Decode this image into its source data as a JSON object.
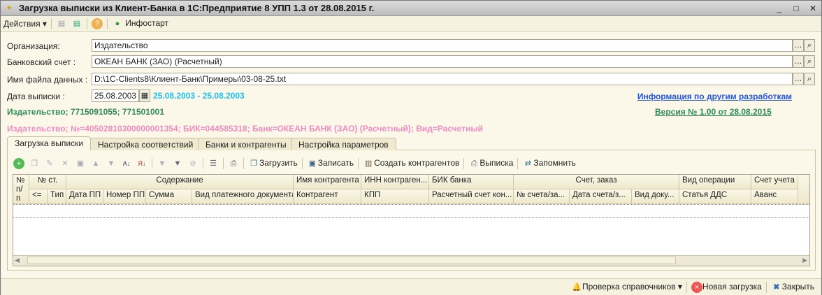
{
  "window": {
    "title": "Загрузка выписки из Клиент-Банка в 1С:Предприятие 8 УПП 1.3 от 28.08.2015 г."
  },
  "toolbar": {
    "actions": "Действия",
    "infostart": "Инфостарт"
  },
  "form": {
    "org_label": "Организация:",
    "org_value": "Издательство",
    "account_label": "Банковский счет :",
    "account_value": "ОКЕАН БАНК (ЗАО) (Расчетный)",
    "file_label": "Имя файла данных :",
    "file_value": "D:\\1C-Clients8\\Клиент-Банк\\Примеры\\03-08-25.txt",
    "date_label": "Дата выписки :",
    "date_value": "25.08.2003",
    "date_range": "25.08.2003 - 25.08.2003",
    "other_dev_link": "Информация по другим разработкам",
    "org_info": "Издательство; 7715091055; 771501001",
    "version_link": "Версия № 1.00 от 28.08.2015",
    "account_info": "Издательство; №=40502810300000001354; БИК=044585318; Банк=ОКЕАН БАНК (ЗАО) (Расчетный); Вид=Расчетный"
  },
  "tabs": [
    "Загрузка выписки",
    "Настройка соответствий",
    "Банки и контрагенты",
    "Настройка параметров"
  ],
  "table_toolbar": {
    "load": "Загрузить",
    "save": "Записать",
    "create": "Создать контрагентов",
    "statement": "Выписка",
    "remember": "Запомнить"
  },
  "table": {
    "h": {
      "num": "№ п/п",
      "nst": "№ ст.",
      "content": "Содержание",
      "name": "Имя контрагента",
      "inn": "ИНН контраген...",
      "bik": "БИК банка",
      "order": "Счет, заказ",
      "op": "Вид операции",
      "acc": "Счет учета"
    },
    "s": {
      "back": "<=",
      "type": "Тип",
      "date": "Дата ПП",
      "number": "Номер ПП",
      "sum": "Сумма",
      "doc": "Вид платежного документа",
      "contr": "Контрагент",
      "kpp": "КПП",
      "rs": "Расчетный счет кон...",
      "ordnum": "№  счета/за...",
      "orddate": "Дата счета/з...",
      "orddoc": "Вид доку...",
      "dds": "Статья ДДС",
      "adv": "Аванс"
    }
  },
  "bottom": {
    "check": "Проверка справочников",
    "new": "Новая загрузка",
    "close": "Закрыть"
  }
}
